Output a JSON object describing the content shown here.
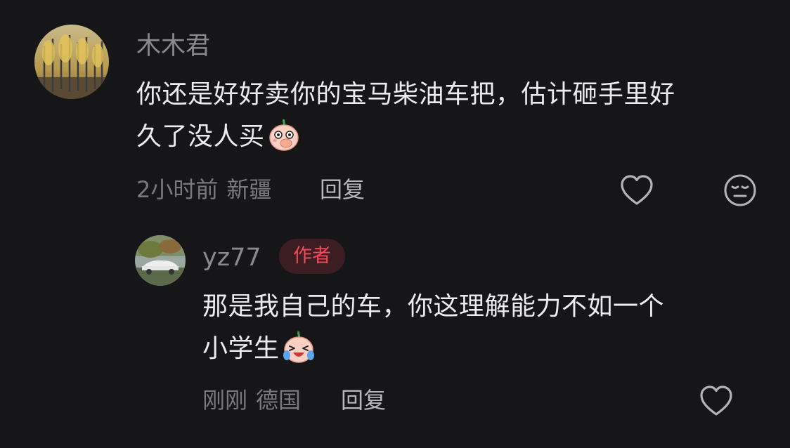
{
  "comment": {
    "username": "木木君",
    "text_line1": "你还是好好卖你的宝马柴油车把，估计砸手里好",
    "text_line2": "久了没人买",
    "emoji_icon": "cover-mouth-emoji-icon",
    "time": "2小时前",
    "location": "新疆",
    "reply_label": "回复"
  },
  "reply": {
    "username": "yz77",
    "badge": "作者",
    "text_line1": "那是我自己的车，你这理解能力不如一个",
    "text_line2": "小学生",
    "emoji_icon": "laugh-cry-emoji-icon",
    "time": "刚刚",
    "location": "德国",
    "reply_label": "回复"
  },
  "colors": {
    "background": "#161618",
    "username": "#8a8a8d",
    "text": "#ececee",
    "meta": "#7a7a7e",
    "badge_text": "#f04a5c",
    "badge_bg": "#3b1d22"
  }
}
